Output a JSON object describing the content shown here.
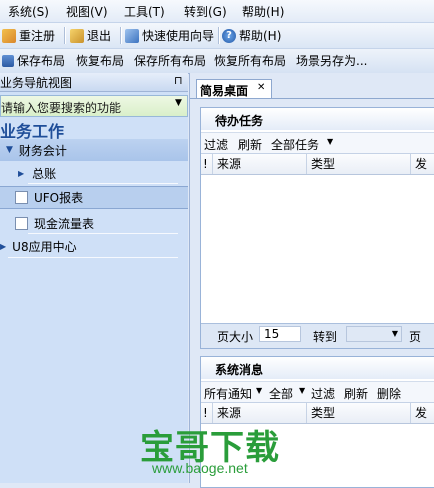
{
  "menu": [
    "系统(S)",
    "视图(V)",
    "工具(T)",
    "转到(G)",
    "帮助(H)"
  ],
  "toolbar1": {
    "relogin": "重注册",
    "exit": "退出",
    "wizard": "快速使用向导",
    "help": "帮助(H)"
  },
  "toolbar2": [
    "保存布局",
    "恢复布局",
    "保存所有布局",
    "恢复所有布局",
    "场景另存为..."
  ],
  "left": {
    "title": "业务导航视图",
    "pin": "⊓",
    "search_placeholder": "请输入您要搜索的功能",
    "section": "业务工作",
    "tree": [
      {
        "label": "财务会计"
      },
      {
        "label": "总账"
      },
      {
        "label": "UFO报表"
      },
      {
        "label": "现金流量表"
      },
      {
        "label": "U8应用中心"
      }
    ]
  },
  "right": {
    "tab_label": "简易桌面",
    "tab_close": "✕",
    "todo": {
      "title": "待办任务",
      "tools": [
        "过滤",
        "刷新",
        "全部任务"
      ],
      "columns": [
        "!",
        "来源",
        "类型",
        "发"
      ],
      "page_size_label": "页大小",
      "page_size_value": "15",
      "goto_label": "转到",
      "page_label": "页"
    },
    "messages": {
      "title": "系统消息",
      "tools": [
        "所有通知",
        "全部",
        "过滤",
        "刷新",
        "删除"
      ],
      "columns": [
        "!",
        "来源",
        "类型",
        "发"
      ]
    }
  },
  "watermark": {
    "title": "宝哥下载",
    "url": "www.baoge.net"
  },
  "colors": {
    "accent": "#1f4e99",
    "watermark": "#2a9d3a"
  }
}
